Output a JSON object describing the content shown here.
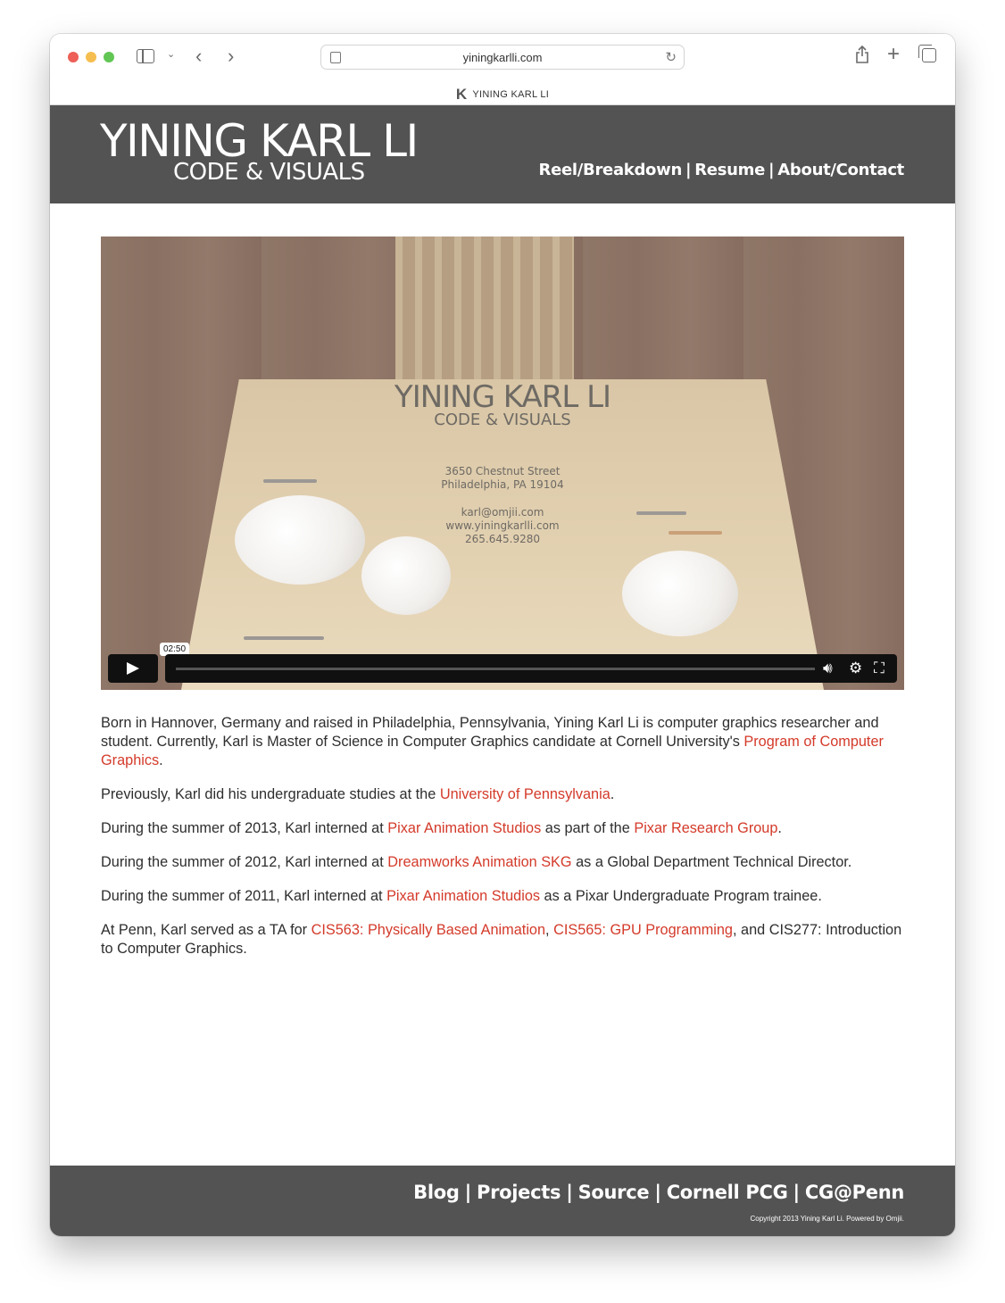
{
  "browser": {
    "url": "yiningkarlli.com",
    "tab_title": "YINING KARL LI",
    "tab_favicon": "K"
  },
  "header": {
    "logo_main": "YINING KARL LI",
    "logo_sub": "CODE & VISUALS",
    "nav": [
      {
        "label": "Reel/Breakdown"
      },
      {
        "label": "Resume"
      },
      {
        "label": "About/Contact"
      }
    ]
  },
  "video": {
    "title": "YINING KARL LI",
    "subtitle": "CODE & VISUALS",
    "address_line1": "3650 Chestnut Street",
    "address_line2": "Philadelphia, PA 19104",
    "email": "karl@omjii.com",
    "website": "www.yiningkarlli.com",
    "phone": "265.645.9280",
    "duration": "02:50"
  },
  "content": {
    "p1_text1": "Born in Hannover, Germany and raised in Philadelphia, Pennsylvania, Yining Karl Li is computer graphics researcher and student. Currently, Karl is Master of Science in Computer Graphics candidate at Cornell University's ",
    "p1_link": "Program of Computer Graphics",
    "p1_text2": ".",
    "p2_text1": "Previously, Karl did his undergraduate studies at the ",
    "p2_link": "University of Pennsylvania",
    "p2_text2": ".",
    "p3_text1": "During the summer of 2013, Karl interned at ",
    "p3_link1": "Pixar Animation Studios",
    "p3_text2": " as part of the ",
    "p3_link2": "Pixar Research Group",
    "p3_text3": ".",
    "p4_text1": "During the summer of 2012, Karl interned at ",
    "p4_link": "Dreamworks Animation SKG",
    "p4_text2": " as a Global Department Technical Director.",
    "p5_text1": "During the summer of 2011, Karl interned at ",
    "p5_link": "Pixar Animation Studios",
    "p5_text2": " as a Pixar Undergraduate Program trainee.",
    "p6_text1": "At Penn, Karl served as a TA for ",
    "p6_link1": "CIS563: Physically Based Animation",
    "p6_text2": ", ",
    "p6_link2": "CIS565: GPU Programming",
    "p6_text3": ", and CIS277: Introduction to Computer Graphics."
  },
  "footer": {
    "nav": [
      {
        "label": "Blog"
      },
      {
        "label": "Projects"
      },
      {
        "label": "Source"
      },
      {
        "label": "Cornell PCG"
      },
      {
        "label": "CG@Penn"
      }
    ],
    "copyright": "Copyright 2013 Yining Karl Li. Powered by Omjii."
  },
  "colors": {
    "header_bg": "#535353",
    "link": "#d43a2a"
  }
}
